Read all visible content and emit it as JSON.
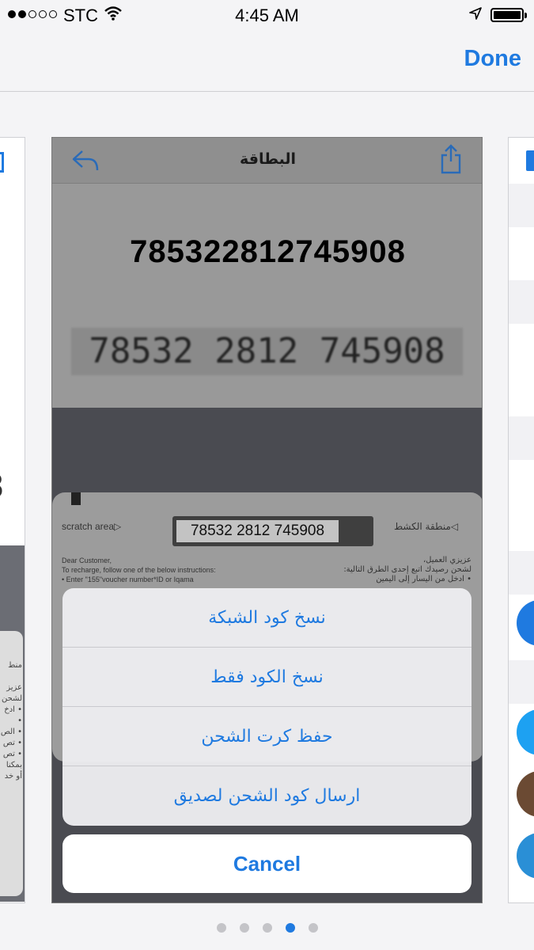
{
  "status_bar": {
    "carrier": "STC",
    "time": "4:45 AM",
    "signal_bars_filled": 2,
    "signal_bars_total": 5
  },
  "nav": {
    "done_label": "Done"
  },
  "preview": {
    "title": "البطاقة",
    "code": "785322812745908",
    "scanned_code": "78532 2812 745908",
    "card": {
      "scratch_area_en": "scratch area▷",
      "scratch_area_ar": "◁منطقة الكشط",
      "printed_code": "78532 2812 745908",
      "instructions_en": "Dear Customer,\nTo recharge, follow one of the below instructions:\n• Enter \"155\"voucher number*ID or Iqama",
      "instructions_ar": "عزيزي العميل،\nلشحن رصيدك اتبع إحدى الطرق التالية:\n• ادخل من اليسار إلى اليمين"
    }
  },
  "action_sheet": {
    "items": [
      "نسخ كود الشبكة",
      "نسخ الكود فقط",
      "حفظ كرت الشحن",
      "ارسال كود الشحن لصديق"
    ],
    "cancel_label": "Cancel"
  },
  "pager": {
    "count": 5,
    "active_index": 3
  },
  "colors": {
    "accent": "#1f7ae0",
    "sheet_bg": "#ececf0",
    "dim_overlay": "#4a4b51"
  }
}
